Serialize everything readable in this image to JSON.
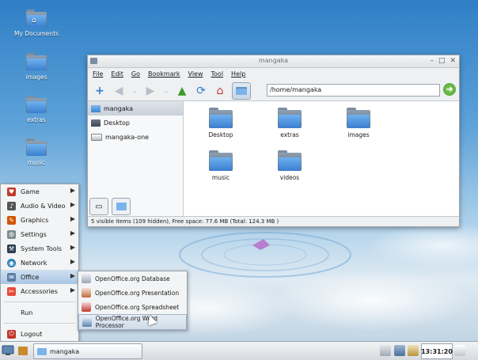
{
  "desktop": {
    "icons": [
      {
        "label": "My Documents",
        "icon": "home-folder-icon"
      },
      {
        "label": "images",
        "icon": "folder-icon"
      },
      {
        "label": "extras",
        "icon": "folder-icon"
      },
      {
        "label": "music",
        "icon": "folder-icon"
      }
    ]
  },
  "filemanager": {
    "title": "mangaka",
    "menu": [
      "File",
      "Edit",
      "Go",
      "Bookmark",
      "View",
      "Tool",
      "Help"
    ],
    "address": "/home/mangaka",
    "places": [
      "mangaka",
      "Desktop",
      "mangaka-one"
    ],
    "files": [
      "Desktop",
      "extras",
      "images",
      "music",
      "videos"
    ],
    "status": "5 visible items (109 hidden), Free space: 77.6 MB (Total: 124.3 MB )"
  },
  "appmenu": {
    "items": [
      {
        "label": "Game",
        "has_submenu": true
      },
      {
        "label": "Audio & Video",
        "has_submenu": true
      },
      {
        "label": "Graphics",
        "has_submenu": true
      },
      {
        "label": "Settings",
        "has_submenu": true
      },
      {
        "label": "System Tools",
        "has_submenu": true
      },
      {
        "label": "Network",
        "has_submenu": true
      },
      {
        "label": "Office",
        "has_submenu": true
      },
      {
        "label": "Accessories",
        "has_submenu": true
      }
    ],
    "run": "Run",
    "logout": "Logout"
  },
  "office_submenu": [
    "OpenOffice.org Database",
    "OpenOffice.org Presentation",
    "OpenOffice.org Spreadsheet",
    "OpenOffice.org Word Processor"
  ],
  "taskbar": {
    "task_label": "mangaka",
    "clock": "13:31:20"
  },
  "colors": {
    "accent": "#3a7fd0",
    "menu_highlight": "#a9c6e4"
  }
}
